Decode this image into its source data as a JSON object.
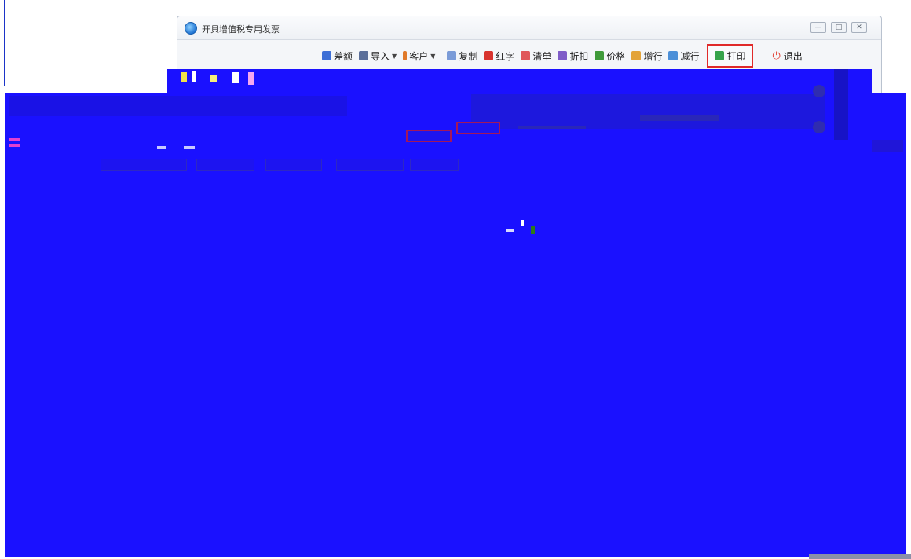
{
  "window": {
    "title": "开具增值税专用发票",
    "controls": {
      "minimize": "—",
      "maximize": "□",
      "close": "✕"
    }
  },
  "toolbar": {
    "items": [
      {
        "label": "差额",
        "icon": "difference-icon",
        "color": "#3d6fd6"
      },
      {
        "label": "导入",
        "icon": "import-icon",
        "color": "#5b6f9a",
        "dropdown": true
      },
      {
        "label": "客户",
        "icon": "customer-icon",
        "color": "#e07a2b",
        "dropdown": true
      },
      {
        "label": "复制",
        "icon": "copy-icon",
        "color": "#7a9bd8"
      },
      {
        "label": "红字",
        "icon": "red-invoice-icon",
        "color": "#d8342f"
      },
      {
        "label": "清单",
        "icon": "list-icon",
        "color": "#e0575a"
      },
      {
        "label": "折扣",
        "icon": "discount-icon",
        "color": "#7f5cc8"
      },
      {
        "label": "价格",
        "icon": "price-icon",
        "color": "#3f9a3a"
      },
      {
        "label": "增行",
        "icon": "add-row-icon",
        "color": "#e3a33a"
      },
      {
        "label": "减行",
        "icon": "delete-row-icon",
        "color": "#4b8fd8"
      }
    ],
    "print_label": "打印",
    "exit_label": "退出"
  },
  "colors": {
    "occlusion": "#1a11ff",
    "highlight": "#e02a2a"
  }
}
